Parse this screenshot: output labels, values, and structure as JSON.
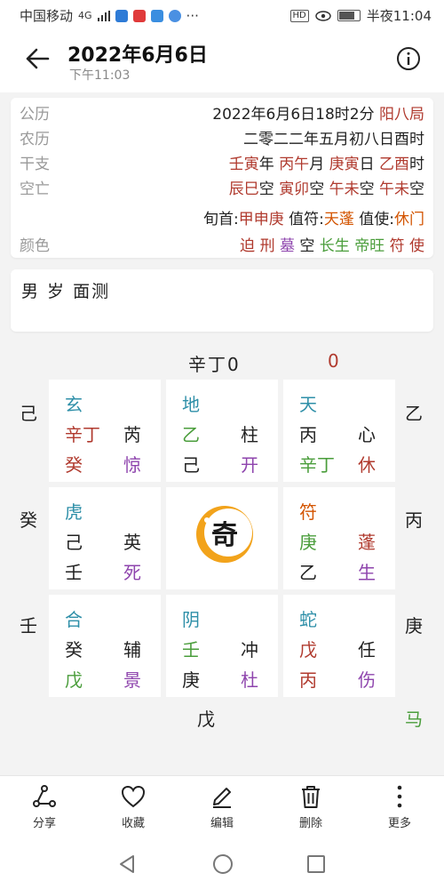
{
  "status_bar": {
    "carrier": "中国移动",
    "signal": "4G",
    "time": "半夜11:04",
    "hd": "HD",
    "more": "···",
    "icons": [
      "signal-icon",
      "app-icon",
      "app-icon",
      "app-icon",
      "music-icon",
      "eye-icon",
      "battery-icon"
    ]
  },
  "header": {
    "title": "2022年6月6日",
    "subtitle": "下午11:03"
  },
  "info": {
    "rows": [
      {
        "label": "公历",
        "value": "2022年6月6日18时2分",
        "extra": "阳八局"
      },
      {
        "label": "农历",
        "value": "二零二二年五月初八日酉时"
      },
      {
        "label": "干支",
        "parts": [
          "壬寅",
          "年",
          "丙午",
          "月",
          "庚寅",
          "日",
          "乙酉",
          "时"
        ]
      },
      {
        "label": "空亡",
        "parts": [
          "辰巳",
          "空",
          "寅卯",
          "空",
          "午未",
          "空",
          "午未",
          "空"
        ]
      },
      {
        "label": "",
        "parts": [
          "旬首:",
          "甲申庚",
          "值符:",
          "天蓬",
          "值使:",
          "休门"
        ]
      },
      {
        "label": "颜色",
        "colors": [
          "迫",
          "刑",
          "墓",
          "空",
          "长生",
          "帝旺",
          "符",
          "使"
        ]
      }
    ]
  },
  "note": {
    "text": "男 岁 面测"
  },
  "chart": {
    "top_text": "辛丁0",
    "top_zero": "0",
    "left": [
      "己",
      "癸",
      "壬"
    ],
    "right": [
      "乙",
      "丙",
      "庚"
    ],
    "bottom": "戊",
    "bottom_right": "马",
    "cells": [
      {
        "god": "玄",
        "a1": "辛丁",
        "b1": "芮",
        "a2": "癸",
        "b2": "惊"
      },
      {
        "god": "地",
        "a1": "乙",
        "b1": "柱",
        "a2": "己",
        "b2": "开"
      },
      {
        "god": "天",
        "a1": "丙",
        "b1": "心",
        "a2": "辛丁",
        "b2": "休"
      },
      {
        "god": "虎",
        "a1": "己",
        "b1": "英",
        "a2": "壬",
        "b2": "死"
      },
      {
        "god": "",
        "a1": "",
        "b1": "",
        "a2": "",
        "b2": ""
      },
      {
        "god": "符",
        "a1": "庚",
        "b1": "蓬",
        "a2": "乙",
        "b2": "生"
      },
      {
        "god": "合",
        "a1": "癸",
        "b1": "辅",
        "a2": "戊",
        "b2": "景"
      },
      {
        "god": "阴",
        "a1": "壬",
        "b1": "冲",
        "a2": "庚",
        "b2": "杜"
      },
      {
        "god": "蛇",
        "a1": "戊",
        "b1": "任",
        "a2": "丙",
        "b2": "伤"
      }
    ],
    "logo_char": "奇"
  },
  "toolbar": {
    "items": [
      {
        "label": "分享",
        "icon": "share-icon"
      },
      {
        "label": "收藏",
        "icon": "heart-icon"
      },
      {
        "label": "编辑",
        "icon": "pen-icon"
      },
      {
        "label": "删除",
        "icon": "trash-icon"
      },
      {
        "label": "更多",
        "icon": "more-icon"
      }
    ]
  }
}
